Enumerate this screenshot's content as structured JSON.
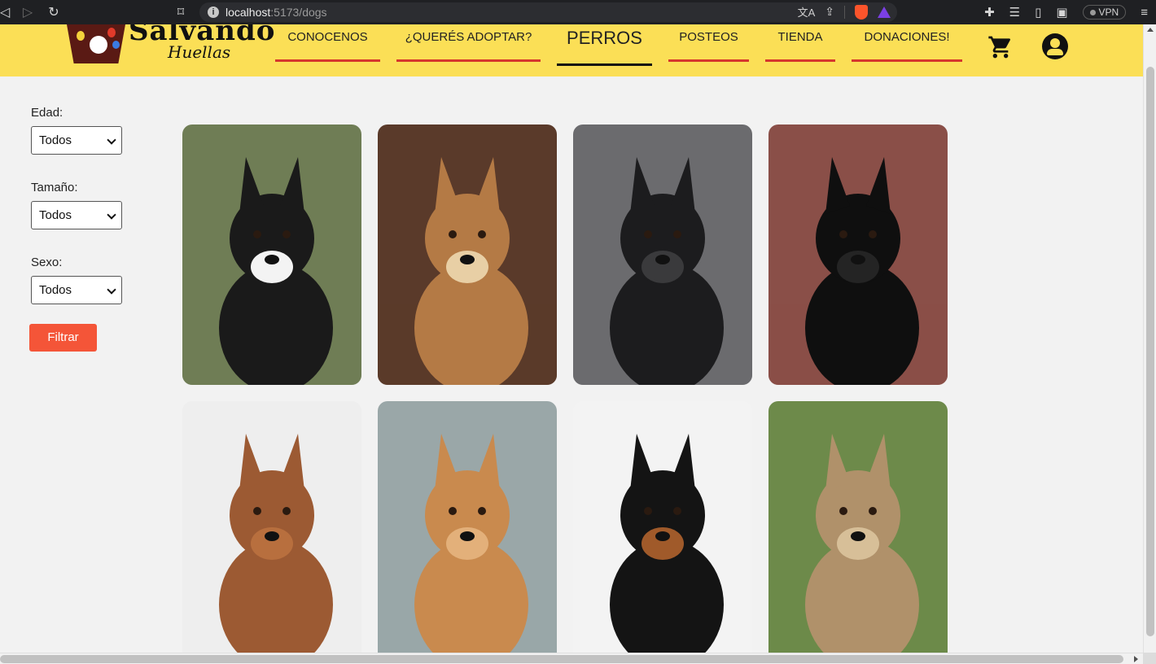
{
  "browser": {
    "url_host": "localhost",
    "url_path": ":5173/dogs",
    "vpn_label": "VPN"
  },
  "header": {
    "logo_text": "Salvando",
    "logo_subtext": "Huellas",
    "menu": [
      {
        "label": "CONOCENOS"
      },
      {
        "label": "¿QUERÉS ADOPTAR?"
      },
      {
        "label": "PERROS"
      },
      {
        "label": "POSTEOS"
      },
      {
        "label": "TIENDA"
      },
      {
        "label": "DONACIONES!"
      }
    ]
  },
  "filters": {
    "age_label": "Edad:",
    "age_value": "Todos",
    "size_label": "Tamaño:",
    "size_value": "Todos",
    "sex_label": "Sexo:",
    "sex_value": "Todos",
    "submit_label": "Filtrar"
  },
  "dogs": [
    {
      "bg": "#6f7d55",
      "fur": "#1a1a1a",
      "accent": "#f3f3f3"
    },
    {
      "bg": "#5a3a2a",
      "fur": "#b47a45",
      "accent": "#e8cfa5"
    },
    {
      "bg": "#6b6b6e",
      "fur": "#1c1c1e",
      "accent": "#3a3a3c"
    },
    {
      "bg": "#8a4f48",
      "fur": "#0f0f0f",
      "accent": "#242424"
    },
    {
      "bg": "#eeeeee",
      "fur": "#9c5a33",
      "accent": "#b86f3e"
    },
    {
      "bg": "#9aa7a8",
      "fur": "#c98a4e",
      "accent": "#e3b07a"
    },
    {
      "bg": "#f3f3f3",
      "fur": "#141414",
      "accent": "#a05a2a"
    },
    {
      "bg": "#6d8a4a",
      "fur": "#b0916a",
      "accent": "#d7bf98"
    }
  ]
}
